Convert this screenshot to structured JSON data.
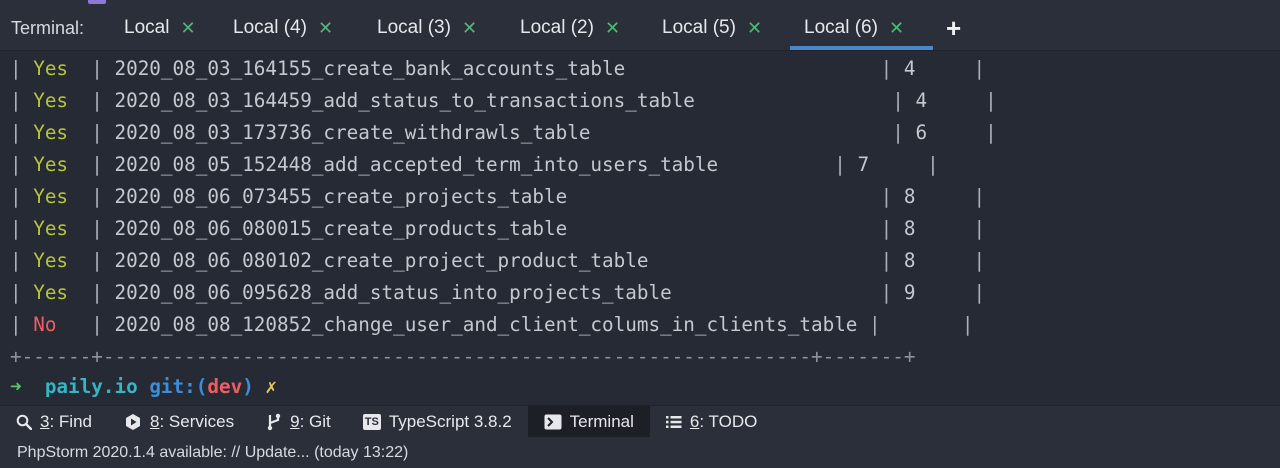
{
  "tabbar": {
    "title": "Terminal:",
    "tabs": [
      {
        "label": "Local",
        "close": "✕"
      },
      {
        "label": "Local (4)",
        "close": "✕"
      },
      {
        "label": "Local (3)",
        "close": "✕"
      },
      {
        "label": "Local (2)",
        "close": "✕"
      },
      {
        "label": "Local (5)",
        "close": "✕"
      },
      {
        "label": "Local (6)",
        "close": "✕"
      }
    ],
    "add": "+"
  },
  "terminal": {
    "rows": [
      {
        "ran": "Yes",
        "migration": "2020_08_03_164155_create_bank_accounts_table",
        "batch": "4"
      },
      {
        "ran": "Yes",
        "migration": "2020_08_03_164459_add_status_to_transactions_table",
        "batch": "4"
      },
      {
        "ran": "Yes",
        "migration": "2020_08_03_173736_create_withdrawls_table",
        "batch": "6"
      },
      {
        "ran": "Yes",
        "migration": "2020_08_05_152448_add_accepted_term_into_users_table",
        "batch": "7"
      },
      {
        "ran": "Yes",
        "migration": "2020_08_06_073455_create_projects_table",
        "batch": "8"
      },
      {
        "ran": "Yes",
        "migration": "2020_08_06_080015_create_products_table",
        "batch": "8"
      },
      {
        "ran": "Yes",
        "migration": "2020_08_06_080102_create_project_product_table",
        "batch": "8"
      },
      {
        "ran": "Yes",
        "migration": "2020_08_06_095628_add_status_into_projects_table",
        "batch": "9"
      },
      {
        "ran": "No",
        "migration": "2020_08_08_120852_change_user_and_client_colums_in_clients_table",
        "batch": ""
      }
    ],
    "separator": "+------+-------------------------------------------------------------+-------+",
    "prompt": {
      "arrow": "➜",
      "host": "paily.io",
      "git_label": "git:(",
      "branch": "dev",
      "git_close": ")",
      "dirty": "✗"
    }
  },
  "toolbar": {
    "items": [
      {
        "icon": "search-icon",
        "num": "3",
        "label": ": Find"
      },
      {
        "icon": "services-icon",
        "num": "8",
        "label": ": Services"
      },
      {
        "icon": "git-icon",
        "num": "9",
        "label": ": Git"
      },
      {
        "icon": "typescript-icon",
        "num": "",
        "label": "TypeScript 3.8.2",
        "badge": "TS"
      },
      {
        "icon": "terminal-icon",
        "num": "",
        "label": "Terminal"
      },
      {
        "icon": "todo-icon",
        "num": "6",
        "label": ": TODO"
      }
    ]
  },
  "status": {
    "text": "PhpStorm 2020.1.4 available: // Update... (today 13:22)"
  }
}
